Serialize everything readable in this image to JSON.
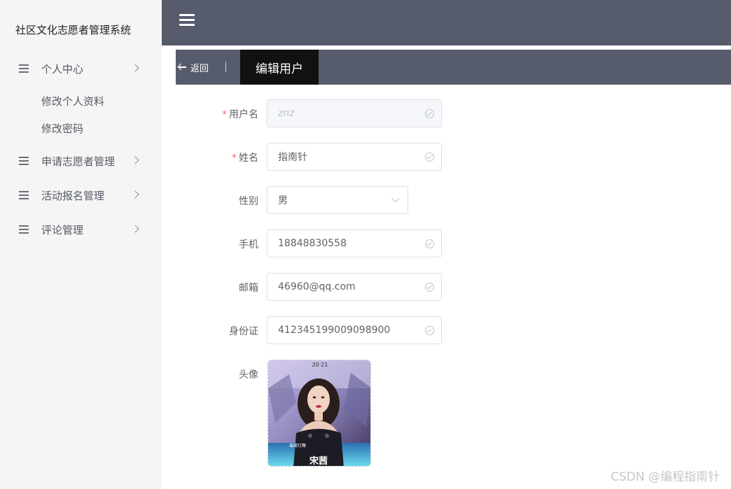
{
  "app": {
    "title": "社区文化志愿者管理系统"
  },
  "sidebar": {
    "items": [
      {
        "label": "个人中心",
        "subitems": [
          {
            "label": "修改个人资料"
          },
          {
            "label": "修改密码"
          }
        ]
      },
      {
        "label": "申请志愿者管理"
      },
      {
        "label": "活动报名管理"
      },
      {
        "label": "评论管理"
      }
    ]
  },
  "header": {
    "back_label": "返回",
    "page_title": "编辑用户"
  },
  "form": {
    "username": {
      "label": "用户名",
      "value": "znz",
      "required": true
    },
    "name": {
      "label": "姓名",
      "value": "指南针",
      "required": true
    },
    "gender": {
      "label": "性别",
      "value": "男"
    },
    "phone": {
      "label": "手机",
      "value": "18848830558"
    },
    "email": {
      "label": "邮箱",
      "value": "46960@qq.com"
    },
    "id_card": {
      "label": "身份证",
      "value": "412345199009098900"
    },
    "avatar": {
      "label": "头像",
      "caption": "宋茜",
      "year": "20·21",
      "subtitle": "璀璨灯舞"
    }
  },
  "watermark": "CSDN @编程指南针",
  "colors": {
    "header_bg": "#575c6c",
    "sidebar_bg": "#f5f5f5",
    "active_tab_bg": "#111111",
    "required": "#f56c6c"
  }
}
